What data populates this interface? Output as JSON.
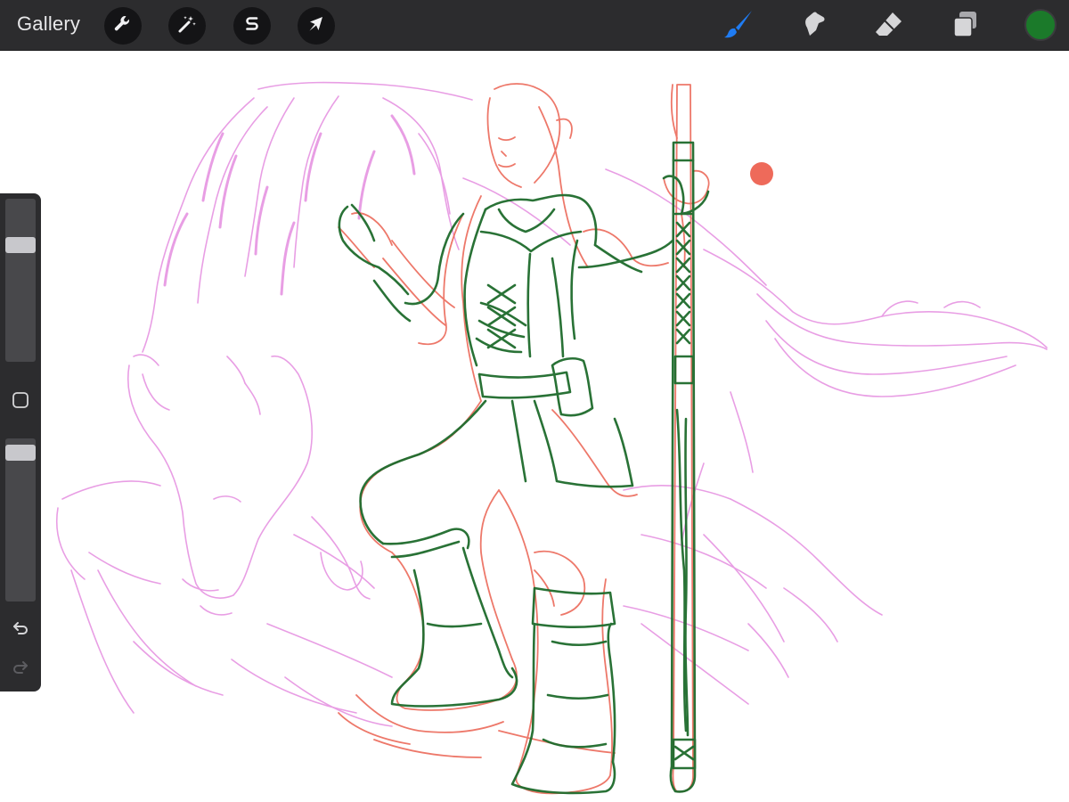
{
  "topbar": {
    "gallery_label": "Gallery",
    "actions_icon": "wrench-icon",
    "adjustments_icon": "magic-wand-icon",
    "selection_icon": "selection-s-icon",
    "transform_icon": "transform-arrow-icon",
    "tools": [
      {
        "name": "brush",
        "icon": "brush-icon",
        "active": true
      },
      {
        "name": "smudge",
        "icon": "smudge-icon",
        "active": false
      },
      {
        "name": "eraser",
        "icon": "eraser-icon",
        "active": false
      },
      {
        "name": "layers",
        "icon": "layers-icon",
        "active": false
      }
    ],
    "current_color": "#1b7a2a"
  },
  "sidebar": {
    "brush_size_level": 0.74,
    "opacity_level": 0.96,
    "modify_icon": "square-icon",
    "undo_icon": "undo-icon",
    "redo_icon": "redo-icon",
    "redo_enabled": false
  },
  "canvas": {
    "layer_colors": {
      "wolf_sketch": "#e58ee0",
      "figure_sketch": "#ec6a5a",
      "figure_lineart": "#1e6b2c",
      "accent_dot": "#ee6a5a"
    }
  },
  "colors": {
    "toolbar_bg": "#2c2c2e",
    "active_tool": "#1f7cf3",
    "inactive_tool": "#d6d6d8"
  }
}
